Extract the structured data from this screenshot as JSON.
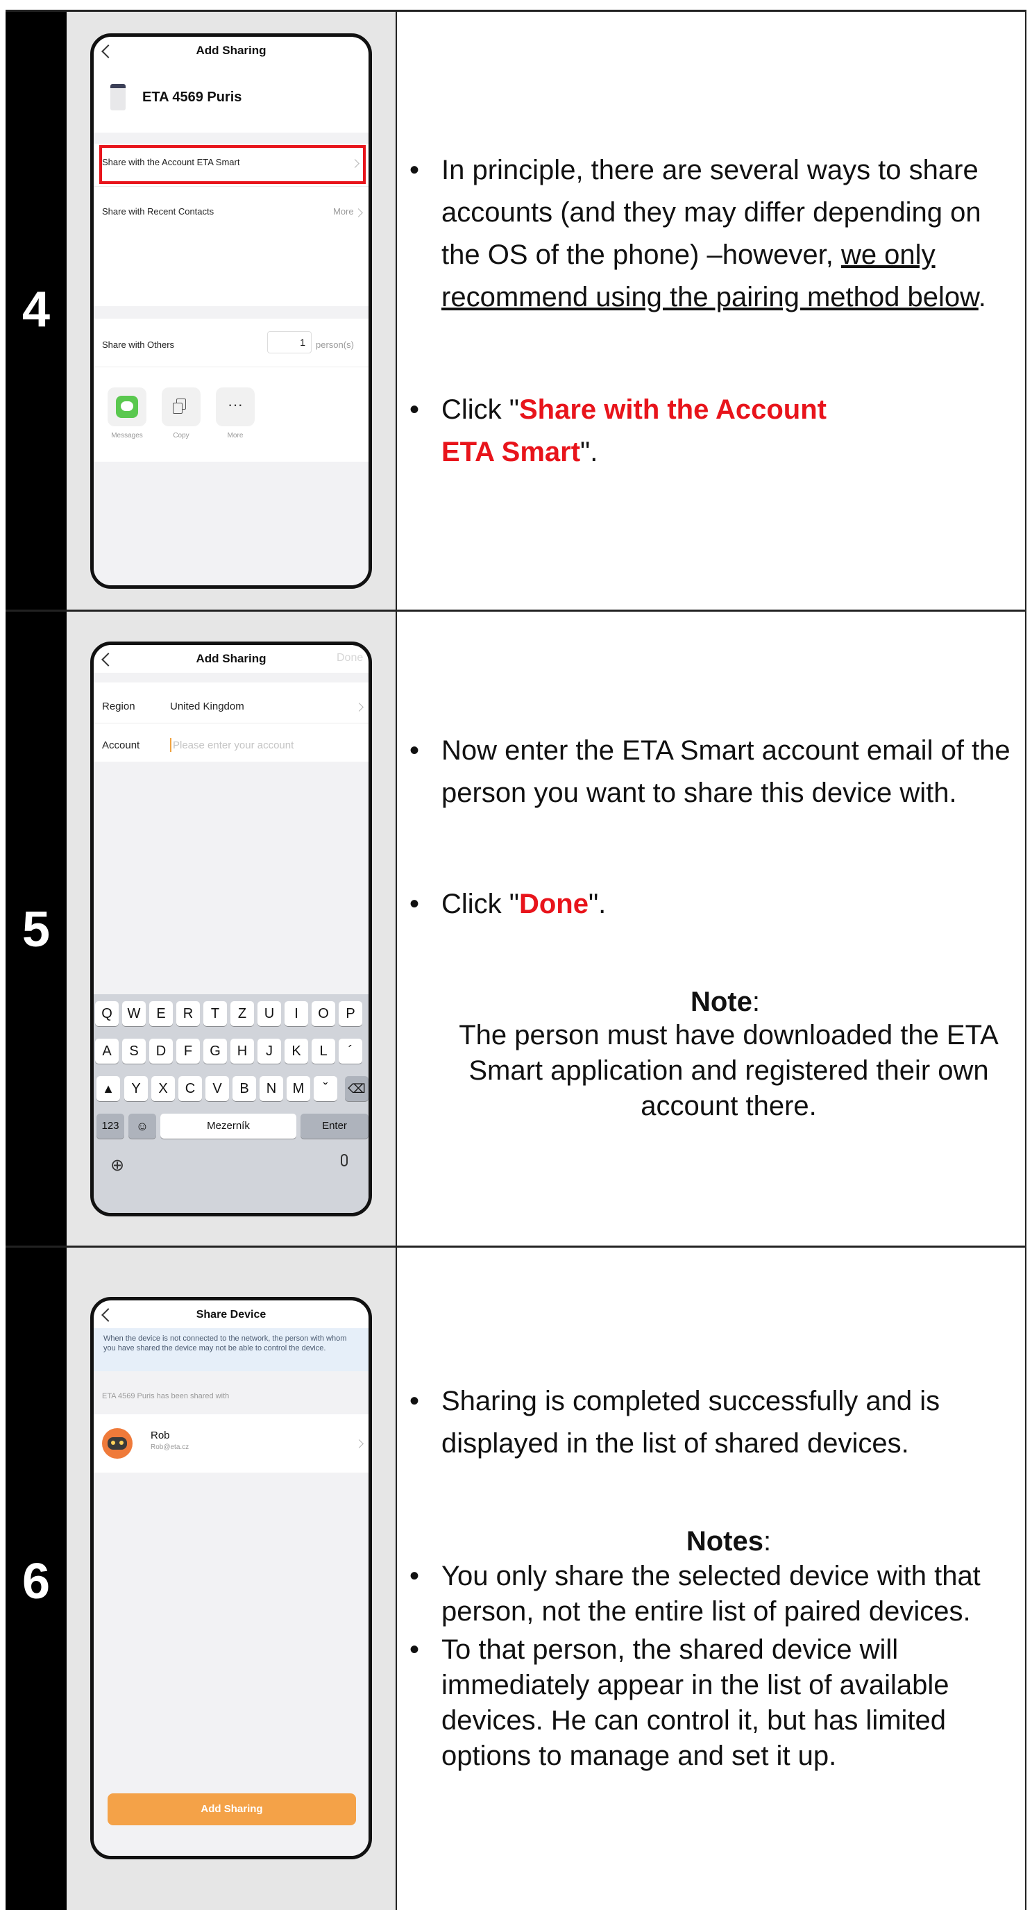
{
  "steps": [
    {
      "number": "4",
      "phone": {
        "title": "Add Sharing",
        "device_name": "ETA 4569 Puris",
        "option_account": "Share with the Account ETA Smart",
        "option_recent": "Share with Recent Contacts",
        "option_recent_more": "More",
        "option_others": "Share with Others",
        "person_count": "1",
        "person_unit": "person(s)",
        "share_apps": [
          "Messages",
          "Copy",
          "More"
        ]
      },
      "text": {
        "b1_part1": "In principle, there are several ways to share accounts (and they may differ depending on the OS of the phone) –however, ",
        "b1_underlined": "we only recommend using the pairing method below",
        "b1_end": ".",
        "b2_prefix": "Click \"",
        "b2_highlight": "Share with the Account ETA Smart",
        "b2_suffix": "\"."
      }
    },
    {
      "number": "5",
      "phone": {
        "title": "Add Sharing",
        "done": "Done",
        "region_label": "Region",
        "region_value": "United Kingdom",
        "account_label": "Account",
        "account_placeholder": "Please enter your account",
        "keyboard_rows": [
          [
            "Q",
            "W",
            "E",
            "R",
            "T",
            "Z",
            "U",
            "I",
            "O",
            "P"
          ],
          [
            "A",
            "S",
            "D",
            "F",
            "G",
            "H",
            "J",
            "K",
            "L",
            "´"
          ],
          [
            "Y",
            "X",
            "C",
            "V",
            "B",
            "N",
            "M",
            "ˇ"
          ]
        ],
        "key_123": "123",
        "key_space": "Mezerník",
        "key_enter": "Enter"
      },
      "text": {
        "b1": "Now enter the ETA Smart account email of the person you want to share this device with.",
        "b2_prefix": "Click \"",
        "b2_highlight": "Done",
        "b2_suffix": "\".",
        "note_title": "Note",
        "note_colon": ":",
        "note_body": "The person must have downloaded the ETA Smart application and registered their own account there."
      }
    },
    {
      "number": "6",
      "phone": {
        "title": "Share Device",
        "notice": "When the device is not connected to the network, the person with whom you have shared the device may not be able to control the device.",
        "shared_with": "ETA 4569 Puris has been shared with",
        "user_name": "Rob",
        "user_email": "Rob@eta.cz",
        "button": "Add Sharing"
      },
      "text": {
        "b1": "Sharing is completed successfully and is displayed in the list of shared devices.",
        "notes_title": "Notes",
        "notes_colon": ":",
        "n1": "You only share the selected device with that person, not the entire list of paired devices.",
        "n2": "To that person, the shared device will immediately appear in the list of available devices. He can control it, but has limited options to manage and set it up."
      }
    }
  ],
  "colors": {
    "highlight_red": "#e8141b",
    "button_orange": "#f4a248",
    "accent_orange": "#f0a340"
  }
}
